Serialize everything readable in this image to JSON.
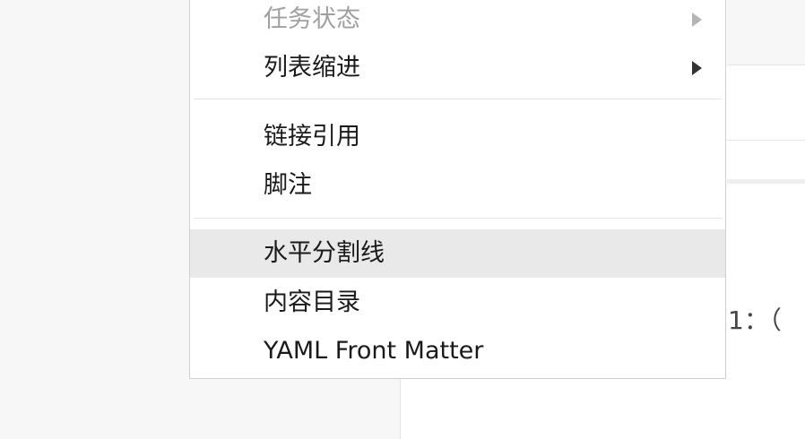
{
  "menu": {
    "items": [
      {
        "label": "任务状态",
        "disabled": true,
        "submenu": true
      },
      {
        "label": "列表缩进",
        "disabled": false,
        "submenu": true
      },
      {
        "label": "链接引用",
        "disabled": false
      },
      {
        "label": "脚注",
        "disabled": false
      },
      {
        "label": "水平分割线",
        "disabled": false,
        "highlighted": true
      },
      {
        "label": "内容目录",
        "disabled": false
      },
      {
        "label": "YAML Front Matter",
        "disabled": false
      }
    ]
  },
  "editor": {
    "visible_text": "1：（"
  },
  "colors": {
    "highlight": "#e9e9e9",
    "disabled_text": "#a0a0a0",
    "text": "#1a1a1a"
  }
}
